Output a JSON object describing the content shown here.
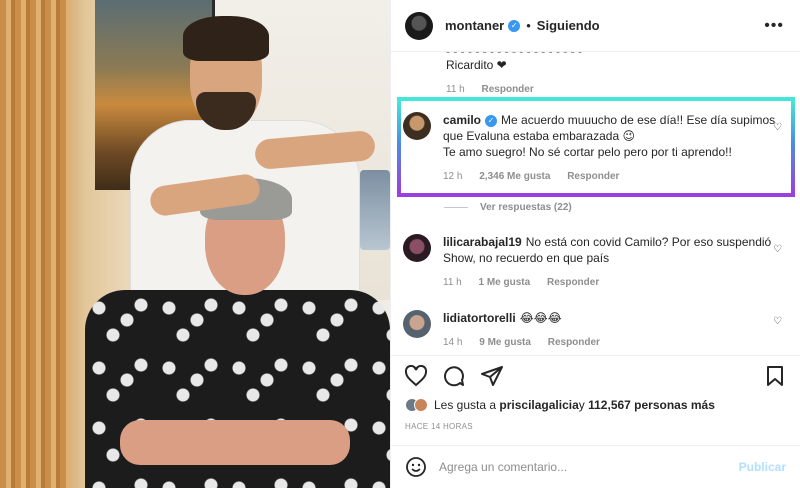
{
  "post": {
    "author": "montaner",
    "separator": "•",
    "follow_status": "Siguiendo",
    "more": "•••"
  },
  "prev_comment": {
    "text_cut": "‐ ‐ ‐ ‐ ‐ ‐ ‐ ‐ ‐ ‐ ‐ ‐ ‐ ‐ ‐ ‐ ‐ ‐ ‐",
    "text": "Ricardito ❤",
    "time": "11 h",
    "reply": "Responder"
  },
  "comments": [
    {
      "user": "camilo",
      "text": "Me acuerdo muuucho de ese día!! Ese día supimos que Evaluna estaba embarazada 😉",
      "text2": "Te amo suegro! No sé cortar pelo pero por ti aprendo!!",
      "time": "12 h",
      "likes": "2,346 Me gusta",
      "reply": "Responder"
    },
    {
      "user": "lilicarabajal19",
      "text": "No está con covid Camilo? Por eso suspendió Show, no recuerdo en que país",
      "time": "11 h",
      "likes": "1 Me gusta",
      "reply": "Responder"
    },
    {
      "user": "lidiatortorelli",
      "text": "😂😂😂",
      "time": "14 h",
      "likes": "9 Me gusta",
      "reply": "Responder"
    }
  ],
  "view_replies": "Ver respuestas (22)",
  "likes_line": {
    "prefix": "Les gusta a ",
    "user": "priscilagalicia",
    "mid": " y ",
    "count": "112,567 personas más"
  },
  "timestamp": "HACE 14 HORAS",
  "add_comment": {
    "placeholder": "Agrega un comentario...",
    "post_label": "Publicar"
  },
  "icons": [
    "verified-icon",
    "more-icon",
    "heart-icon",
    "comment-icon",
    "share-icon",
    "save-icon",
    "emoji-icon"
  ],
  "colors": {
    "accent_blue": "#3897f0",
    "muted": "#8e8e8e",
    "highlight_top": "#43e8d8",
    "highlight_bottom": "#9b3fe0"
  }
}
